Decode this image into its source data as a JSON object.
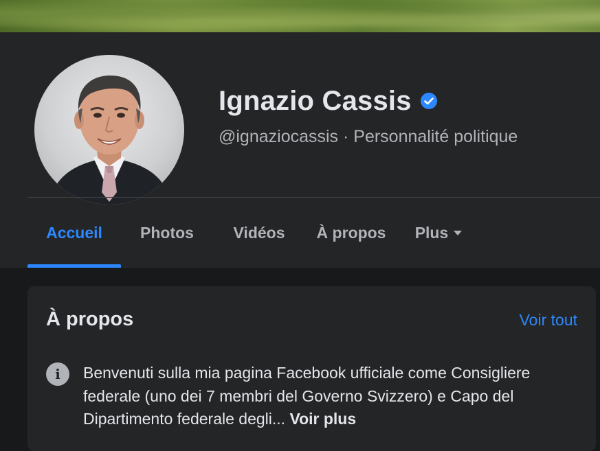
{
  "profile": {
    "name": "Ignazio Cassis",
    "handle": "@ignaziocassis",
    "separator": " · ",
    "category": "Personnalité politique",
    "verified_icon": "verified-badge-icon",
    "accent_color": "#2d88ff"
  },
  "tabs": [
    {
      "label": "Accueil",
      "active": true
    },
    {
      "label": "Photos",
      "active": false
    },
    {
      "label": "Vidéos",
      "active": false
    },
    {
      "label": "À propos",
      "active": false
    },
    {
      "label": "Plus",
      "active": false
    }
  ],
  "about_card": {
    "title": "À propos",
    "see_all": "Voir tout",
    "bio": "Benvenuti sulla mia pagina Facebook ufficiale come Consigliere federale (uno dei 7 membri del Governo Svizzero) e Capo del Dipartimento federale degli...",
    "see_more": "Voir plus",
    "info_icon": "info-icon"
  }
}
